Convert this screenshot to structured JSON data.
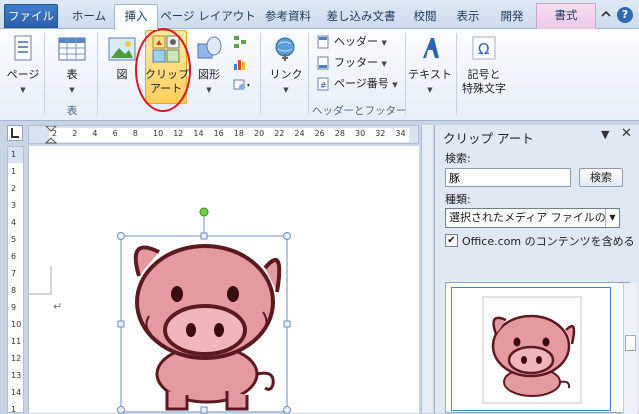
{
  "tabs": {
    "file": "ファイル",
    "home": "ホーム",
    "insert": "挿入",
    "page_layout": "ページ レイアウト",
    "references": "参考資料",
    "mailings": "差し込み文書",
    "review": "校閲",
    "view": "表示",
    "developer": "開発",
    "format": "書式"
  },
  "ribbon": {
    "page": "ページ",
    "table": "表",
    "table_group": "表",
    "picture": "図",
    "clipart_line1": "クリップ",
    "clipart_line2": "アート",
    "shapes": "図形",
    "links": "リンク",
    "header": "ヘッダー",
    "footer": "フッター",
    "page_number": "ページ番号",
    "header_footer_group": "ヘッダーとフッター",
    "textbox": "テキスト",
    "symbol_line1": "記号と",
    "symbol_line2": "特殊文字"
  },
  "ruler": {
    "ticks": [
      "2",
      "2",
      "4",
      "6",
      "8",
      "10",
      "12",
      "14",
      "16",
      "18",
      "20",
      "22",
      "24",
      "26",
      "28",
      "30",
      "32",
      "34"
    ],
    "vticks": [
      "1",
      "1",
      "2",
      "3",
      "4",
      "5",
      "6",
      "7",
      "8",
      "9",
      "10",
      "11",
      "12",
      "13",
      "14",
      "1"
    ]
  },
  "pane": {
    "title": "クリップ アート",
    "search_label": "検索:",
    "search_value": "豚",
    "search_button": "検索",
    "type_label": "種類:",
    "type_value": "選択されたメディア ファイルの種類",
    "include_office": "Office.com のコンテンツを含める"
  },
  "colors": {
    "accent": "#2a5ea8",
    "highlight": "#ffcf5c",
    "annotation": "#e0161b",
    "pig": "#e59aa0"
  }
}
